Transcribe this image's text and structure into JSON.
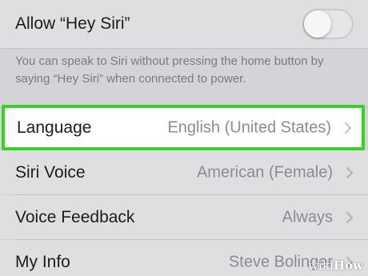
{
  "hey_siri": {
    "label": "Allow “Hey Siri”",
    "toggle_on": false,
    "description": "You can speak to Siri without pressing the home button by saying “Hey Siri” when connected to power."
  },
  "settings": [
    {
      "label": "Language",
      "value": "English (United States)",
      "highlighted": true
    },
    {
      "label": "Siri Voice",
      "value": "American (Female)"
    },
    {
      "label": "Voice Feedback",
      "value": "Always"
    },
    {
      "label": "My Info",
      "value": "Steve Bolinger"
    }
  ],
  "watermark": {
    "prefix": "wiki",
    "suffix": "How"
  },
  "colors": {
    "highlight_border": "#33d61e",
    "background": "#d4d4d8",
    "row_background": "#dfdfe2",
    "secondary_text": "#8b8b90"
  },
  "icons": {
    "disclosure": "chevron-right-icon"
  }
}
